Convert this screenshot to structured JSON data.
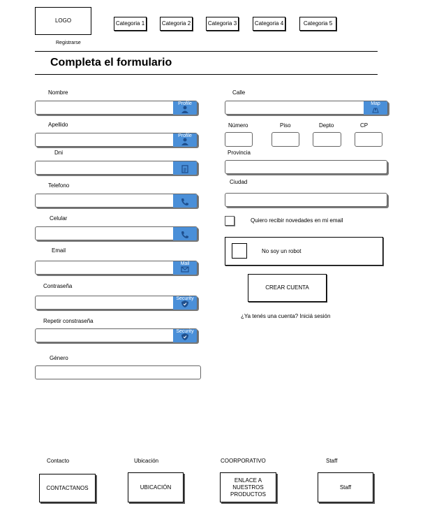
{
  "header": {
    "logo": "LOGO",
    "register": "Registrarse",
    "categories": [
      "Categoria 1",
      "Categoria 2",
      "Categoria 3",
      "Categoria 4",
      "Categoria 5"
    ]
  },
  "form_title": "Completa el formulario",
  "left_fields": [
    {
      "label": "Nombre",
      "icon_caption": "Profile",
      "icon": "profile-icon"
    },
    {
      "label": "Apellido",
      "icon_caption": "Profile",
      "icon": "profile-icon"
    },
    {
      "label": "Dni",
      "icon_caption": "",
      "icon": "document-icon"
    },
    {
      "label": "Telefono",
      "icon_caption": "",
      "icon": "phone-icon"
    },
    {
      "label": "Celular",
      "icon_caption": "",
      "icon": "phone-icon"
    },
    {
      "label": "Email",
      "icon_caption": "Mail",
      "icon": "mail-icon"
    },
    {
      "label": "Contraseña",
      "icon_caption": "Security",
      "icon": "shield-icon"
    },
    {
      "label": "Repetir constraseña",
      "icon_caption": "Security",
      "icon": "shield-icon"
    },
    {
      "label": "Género"
    }
  ],
  "right": {
    "street_label": "Calle",
    "map_caption": "Map",
    "numero_label": "Número",
    "piso_label": "Piso",
    "depto_label": "Depto",
    "cp_label": "CP",
    "provincia_label": "Provincia",
    "ciudad_label": "Ciudad",
    "newsletter_label": "Quiero recibir novedades en mi email",
    "robot_label": "No soy un robot",
    "create_button": "CREAR CUENTA",
    "login_question": "¿Ya tenés una cuenta?",
    "login_link": "Iniciá sesión"
  },
  "footer": {
    "columns": [
      {
        "label": "Contacto",
        "button": "CONTACTANOS"
      },
      {
        "label": "Ubicación",
        "button": "UBICACIÓN"
      },
      {
        "label": "COORPORATIVO",
        "button": "ENLACE A\nNUESTROS\nPRODUCTOS"
      },
      {
        "label": "Staff",
        "button": "Staff"
      }
    ]
  }
}
